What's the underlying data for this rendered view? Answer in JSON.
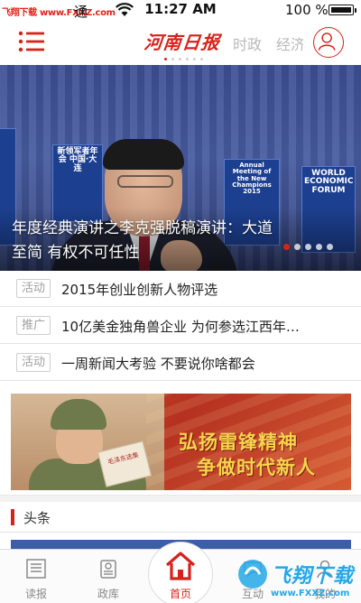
{
  "status_bar": {
    "watermark": "飞翔下载 www.FXXZ.com",
    "carrier": "通",
    "time": "11:27 AM",
    "battery_percent": "100 %",
    "battery_level": 1.0
  },
  "header": {
    "logo": "河南日报",
    "tabs": [
      "时政",
      "经济"
    ],
    "active_page_dot": 0,
    "page_dot_count": 6
  },
  "hero": {
    "caption": "年度经典演讲之李克强脱稿演讲：大道至简 有权不可任性",
    "banner_left": "WORLD ECONOMIC FORUM",
    "banner_mid": "新领军者年会 中国·大连",
    "banner_mid2": "Annual Meeting of the New Champions 2015",
    "banner_right": "WORLD ECONOMIC FORUM",
    "slide_count": 5,
    "active_slide": 0
  },
  "news": [
    {
      "tag": "活动",
      "title": "2015年创业创新人物评选"
    },
    {
      "tag": "推广",
      "title": "10亿美金独角兽企业 为何参选江西年…"
    },
    {
      "tag": "活动",
      "title": "一周新闻大考验  不要说你啥都会"
    }
  ],
  "ad": {
    "line1": "弘扬雷锋精神",
    "line2": "争做时代新人",
    "book_text": "毛泽东选集"
  },
  "section": {
    "title": "头条"
  },
  "tab_bar": {
    "items": [
      {
        "label": "读报",
        "icon": "newspaper-icon"
      },
      {
        "label": "政库",
        "icon": "database-icon"
      },
      {
        "label": "首页",
        "icon": "home-icon"
      },
      {
        "label": "互动",
        "icon": "chat-icon"
      },
      {
        "label": "我的",
        "icon": "user-icon"
      }
    ]
  },
  "watermark": {
    "text": "飞翔下载",
    "url": "www.FXXZ.com"
  },
  "colors": {
    "accent": "#d7221b",
    "tag_border": "#cfcfcf",
    "watermark": "#23a8e8"
  }
}
